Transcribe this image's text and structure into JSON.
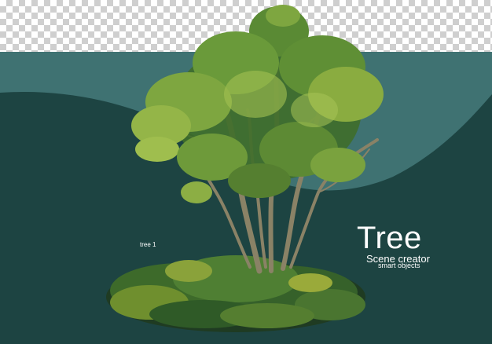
{
  "scene": {
    "colors": {
      "transparent_checker": "#cfcfcf",
      "light_band": "#3f7272",
      "dark_ground": "#1d4442",
      "foliage": "#6e9a3a",
      "trunk": "#8a8266"
    }
  },
  "text": {
    "title": "Tree",
    "subtitle": "Scene creator",
    "tagline": "smart objects",
    "label": "tree 1"
  }
}
